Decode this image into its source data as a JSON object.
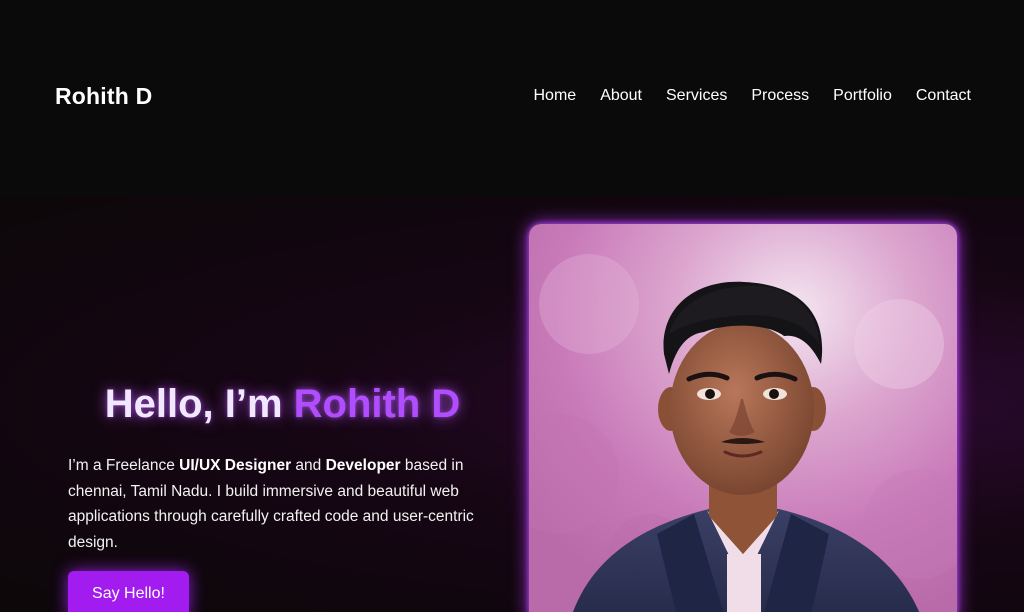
{
  "header": {
    "brand": "Rohith D",
    "nav": [
      {
        "label": "Home"
      },
      {
        "label": "About"
      },
      {
        "label": "Services"
      },
      {
        "label": "Process"
      },
      {
        "label": "Portfolio"
      },
      {
        "label": "Contact"
      }
    ]
  },
  "hero": {
    "greeting": "Hello, I’m ",
    "name": "Rohith D",
    "intro_1": "I’m a Freelance ",
    "role_1": "UI/UX Designer",
    "intro_2": " and ",
    "role_2": "Developer",
    "intro_3": " based in chennai, Tamil Nadu. I build immersive and beautiful web applications through carefully crafted code and user-centric design.",
    "cta_label": "Say Hello!"
  },
  "colors": {
    "background": "#0a0a0a",
    "accent": "#b04dff",
    "button": "#a21cf0"
  },
  "icons": {
    "portrait": "profile-photo"
  }
}
